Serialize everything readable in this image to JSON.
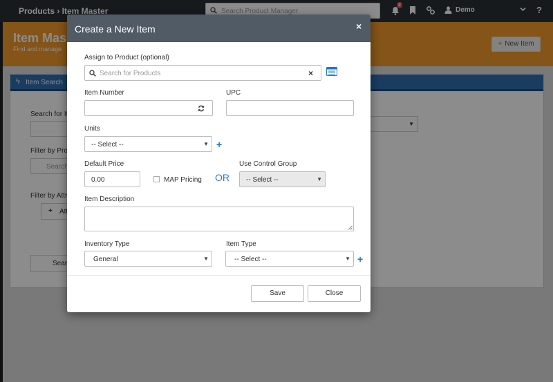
{
  "topbar": {
    "breadcrumb": "Products › Item Master",
    "search_placeholder": "Search Product Manager",
    "notification_count": "2",
    "user_name": "Demo"
  },
  "header": {
    "title": "Item Mas",
    "subtitle": "Find and manage",
    "new_item_label": "New Item"
  },
  "panel": {
    "title": "Item Search",
    "search_label": "Search for It",
    "filter_product_label": "Filter by Pro",
    "filter_product_placeholder": "Search",
    "filter_attr_label": "Filter by Attr",
    "attr_button_label": "Att",
    "search_button_label": "Sear"
  },
  "modal": {
    "title": "Create a New Item",
    "assign_label": "Assign to Product (optional)",
    "assign_placeholder": "Search for Products",
    "item_number_label": "Item Number",
    "item_number_value": "",
    "upc_label": "UPC",
    "upc_value": "",
    "units_label": "Units",
    "units_value": "-- Select --",
    "default_price_label": "Default Price",
    "default_price_value": "0.00",
    "map_pricing_label": "MAP Pricing",
    "map_pricing_checked": false,
    "or_label": "OR",
    "control_group_label": "Use Control Group",
    "control_group_value": "-- Select --",
    "description_label": "Item Description",
    "description_value": "",
    "inventory_type_label": "Inventory Type",
    "inventory_type_value": "General",
    "item_type_label": "Item Type",
    "item_type_value": "-- Select --",
    "save_label": "Save",
    "close_label": "Close"
  },
  "colors": {
    "topbar": "#2b3035",
    "header_orange": "#f09a2d",
    "panel_blue": "#2e6db0",
    "modal_header": "#505b66",
    "accent_blue": "#1e78c8"
  }
}
